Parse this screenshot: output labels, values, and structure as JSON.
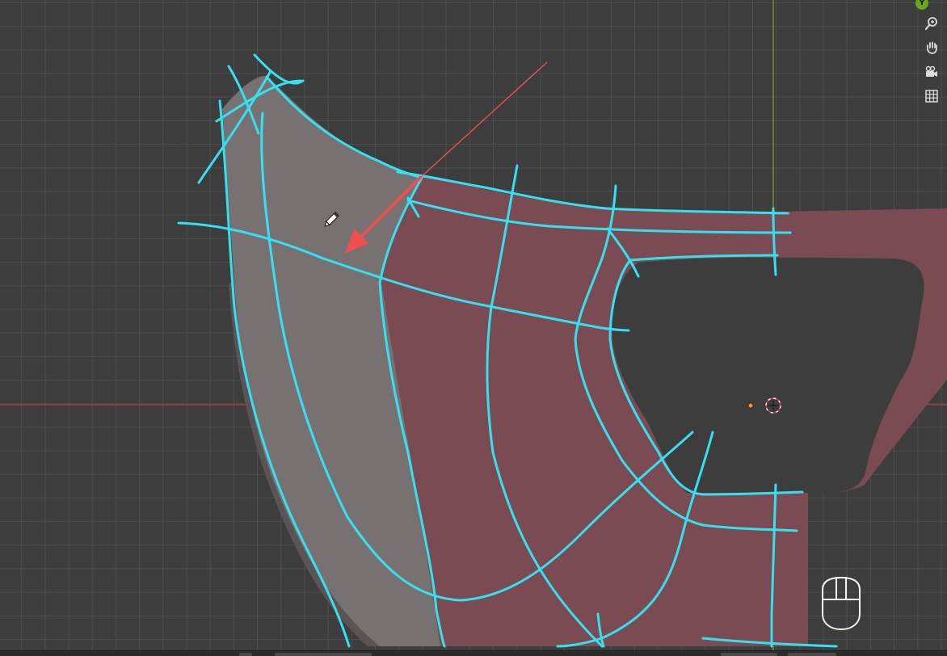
{
  "viewport": {
    "axis_label_y": "Y",
    "colors": {
      "background": "#3d3d3d",
      "grid": "#505050",
      "axis_x": "#b83a4a",
      "axis_y": "#7ea82a",
      "sketch_stroke": "#35e1f0",
      "annotation_arrow": "#ef4f4f",
      "mesh_grey": "#787171",
      "mesh_red": "#7a4b52"
    }
  },
  "navigation_gizmo": {
    "buttons": [
      {
        "icon": "zoom-icon"
      },
      {
        "icon": "hand-pan-icon"
      },
      {
        "icon": "camera-icon"
      },
      {
        "icon": "grid-view-icon"
      }
    ]
  },
  "overlay": {
    "cursor_icon": "pencil-icon",
    "mouse_hint_icon": "mouse-icon"
  }
}
